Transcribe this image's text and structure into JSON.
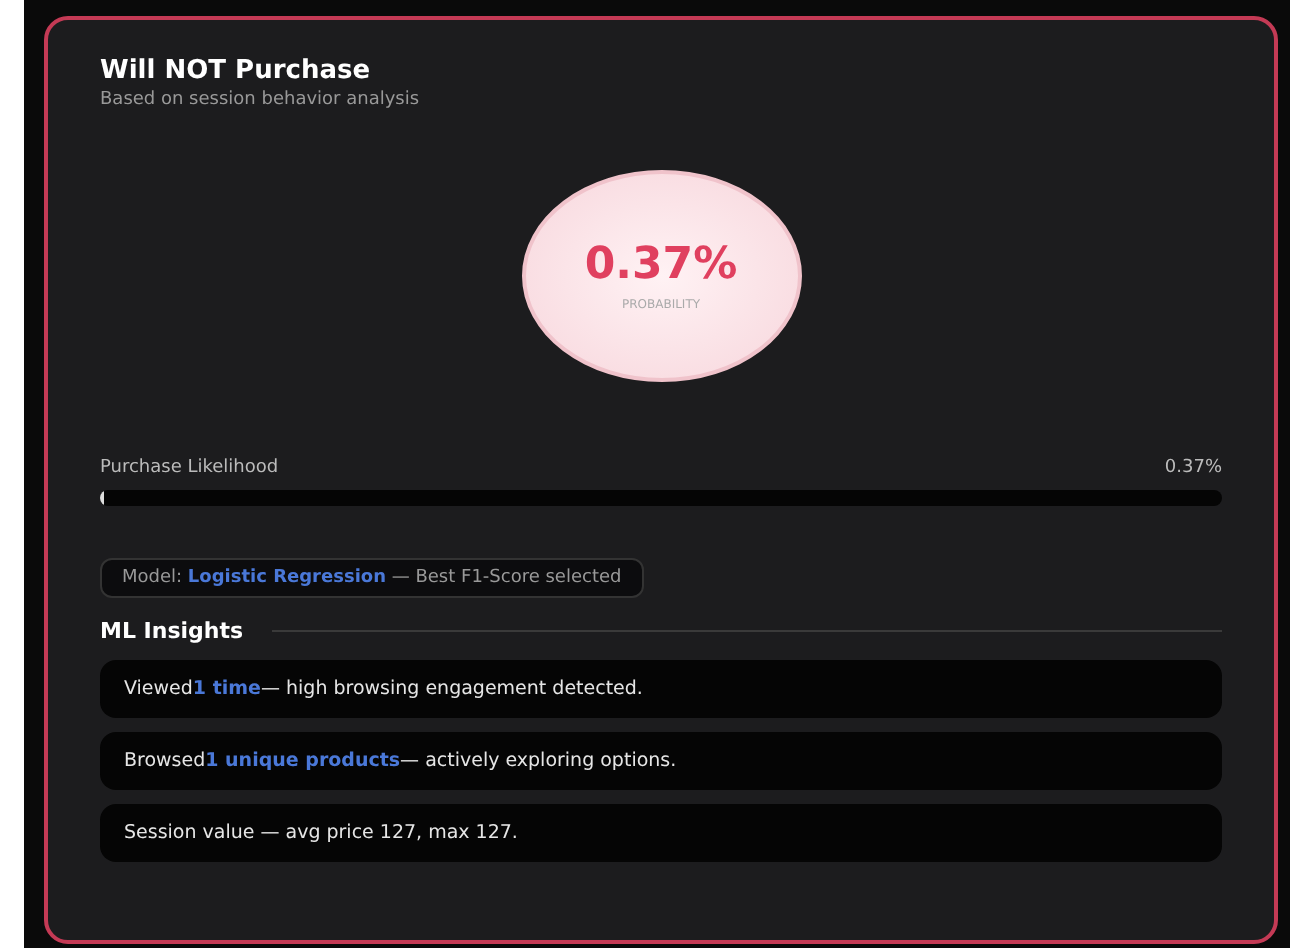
{
  "header": {
    "title": "Will NOT Purchase",
    "subtitle": "Based on session behavior analysis"
  },
  "probability": {
    "value": "0.37%",
    "label": "PROBABILITY"
  },
  "likelihood": {
    "label": "Purchase Likelihood",
    "reading": "0.37%",
    "level": 0.0037
  },
  "model": {
    "prefix": "Model:",
    "name": "Logistic Regression",
    "suffix": "— Best F1-Score selected"
  },
  "insights": {
    "title": "ML Insights",
    "items": [
      {
        "before": "Viewed",
        "highlight": "1 time",
        "after": "— high browsing engagement detected."
      },
      {
        "before": "Browsed",
        "highlight": "1 unique products",
        "after": "— actively exploring options."
      },
      {
        "before": "Session value — avg price 127, max 127."
      }
    ]
  }
}
